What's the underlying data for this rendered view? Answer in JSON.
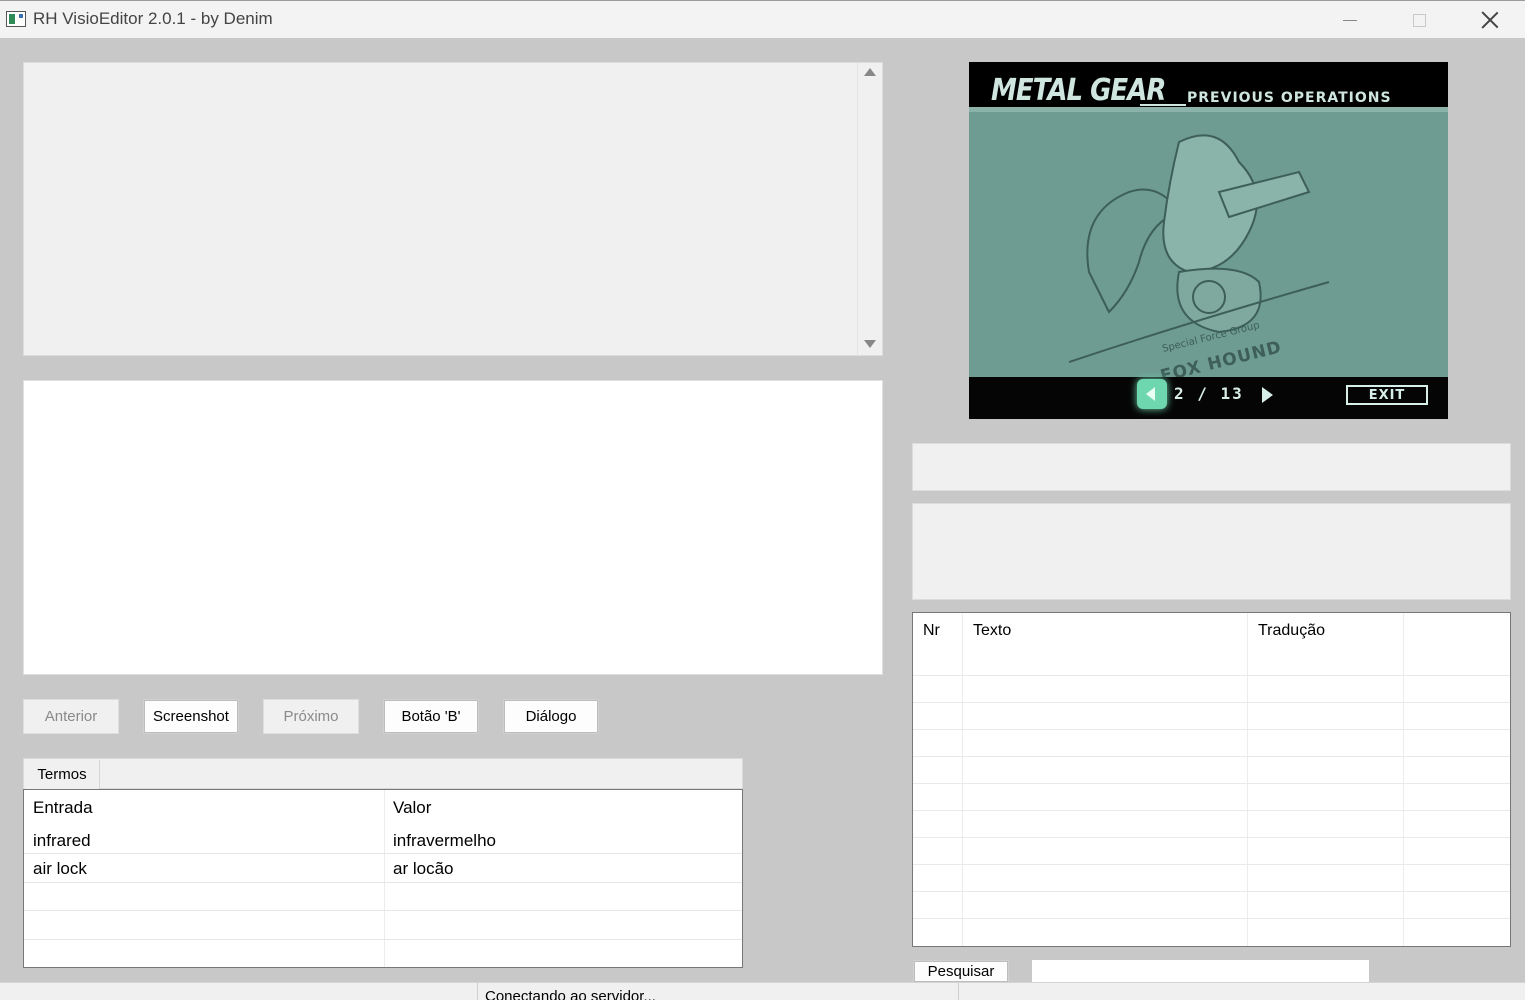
{
  "window": {
    "title": "RH VisioEditor 2.0.1 - by Denim"
  },
  "buttons": {
    "anterior": "Anterior",
    "screenshot": "Screenshot",
    "proximo": "Próximo",
    "botao_b": "Botão 'B'",
    "dialogo": "Diálogo",
    "pesquisar": "Pesquisar"
  },
  "terms": {
    "tab": "Termos",
    "columns": [
      "Entrada",
      "Valor"
    ],
    "rows": [
      [
        "infrared",
        "infravermelho"
      ],
      [
        "air lock",
        "ar locão"
      ]
    ]
  },
  "game_screen": {
    "logo": "METAL GEAR",
    "subtitle": "PREVIOUS OPERATIONS",
    "page": "2 / 13",
    "exit": "EXIT",
    "emblem_text": "FOX HOUND",
    "emblem_small": "Special Force Group"
  },
  "lines_table": {
    "columns": [
      "Nr",
      "Texto",
      "Tradução"
    ]
  },
  "search": {
    "value": ""
  },
  "status": {
    "text": "Conectando ao servidor..."
  },
  "icons": {
    "app": "app-icon",
    "minimize": "minimize-icon",
    "maximize": "maximize-icon",
    "close": "close-icon",
    "scroll_up": "arrow-up-icon",
    "scroll_down": "arrow-down-icon"
  }
}
